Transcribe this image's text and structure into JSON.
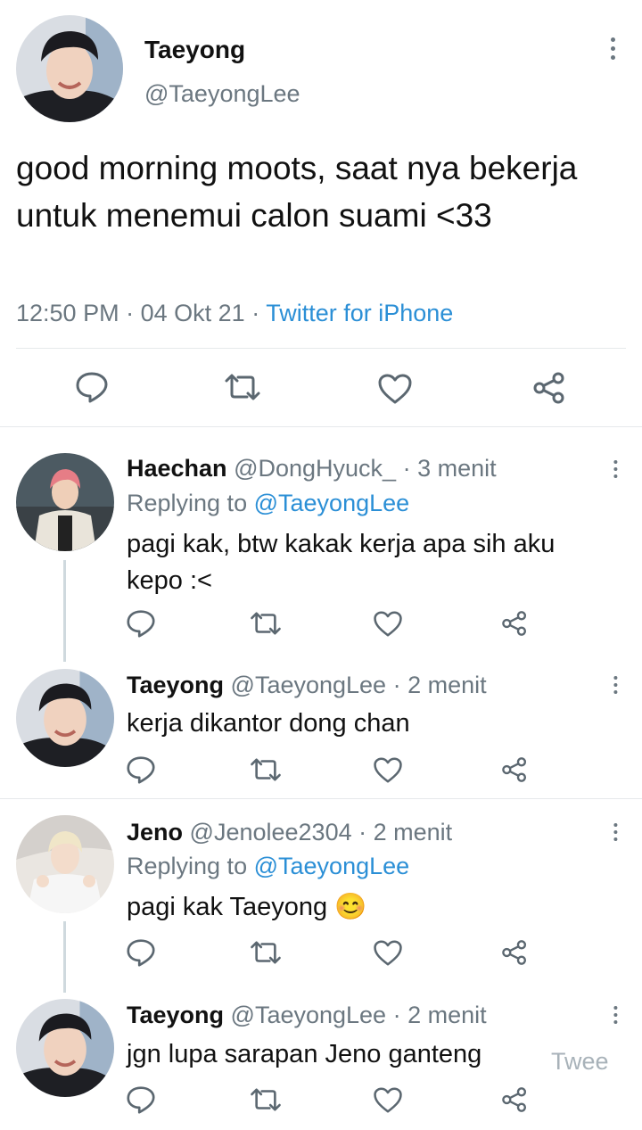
{
  "main_tweet": {
    "name": "Taeyong",
    "handle": "@TaeyongLee",
    "text": "good morning moots, saat nya bekerja untuk menemui calon suami <33",
    "time": "12:50 PM",
    "date": "04 Okt 21",
    "separator": "·",
    "source": "Twitter for iPhone"
  },
  "replies": [
    {
      "name": "Haechan",
      "handle": "@DongHyuck_",
      "time": "3 menit",
      "replying_label": "Replying to",
      "replying_handle": "@TaeyongLee",
      "text": "pagi kak, btw kakak kerja apa sih aku kepo :<"
    },
    {
      "name": "Taeyong",
      "handle": "@TaeyongLee",
      "time": "2 menit",
      "text": "kerja dikantor dong chan"
    },
    {
      "name": "Jeno",
      "handle": "@Jenolee2304",
      "time": "2 menit",
      "replying_label": "Replying to",
      "replying_handle": "@TaeyongLee",
      "text": "pagi kak Taeyong",
      "emoji": "😊"
    },
    {
      "name": "Taeyong",
      "handle": "@TaeyongLee",
      "time": "2 menit",
      "text": "jgn lupa sarapan Jeno ganteng"
    }
  ],
  "tweet_button_label": "Twee",
  "separator": "·",
  "icons": [
    "more-vertical-icon",
    "reply-icon",
    "retweet-icon",
    "like-icon",
    "share-icon"
  ],
  "colors": {
    "link": "#2b8fd6",
    "secondary": "#6b7780",
    "text": "#111111",
    "divider": "#e6e9eb"
  }
}
